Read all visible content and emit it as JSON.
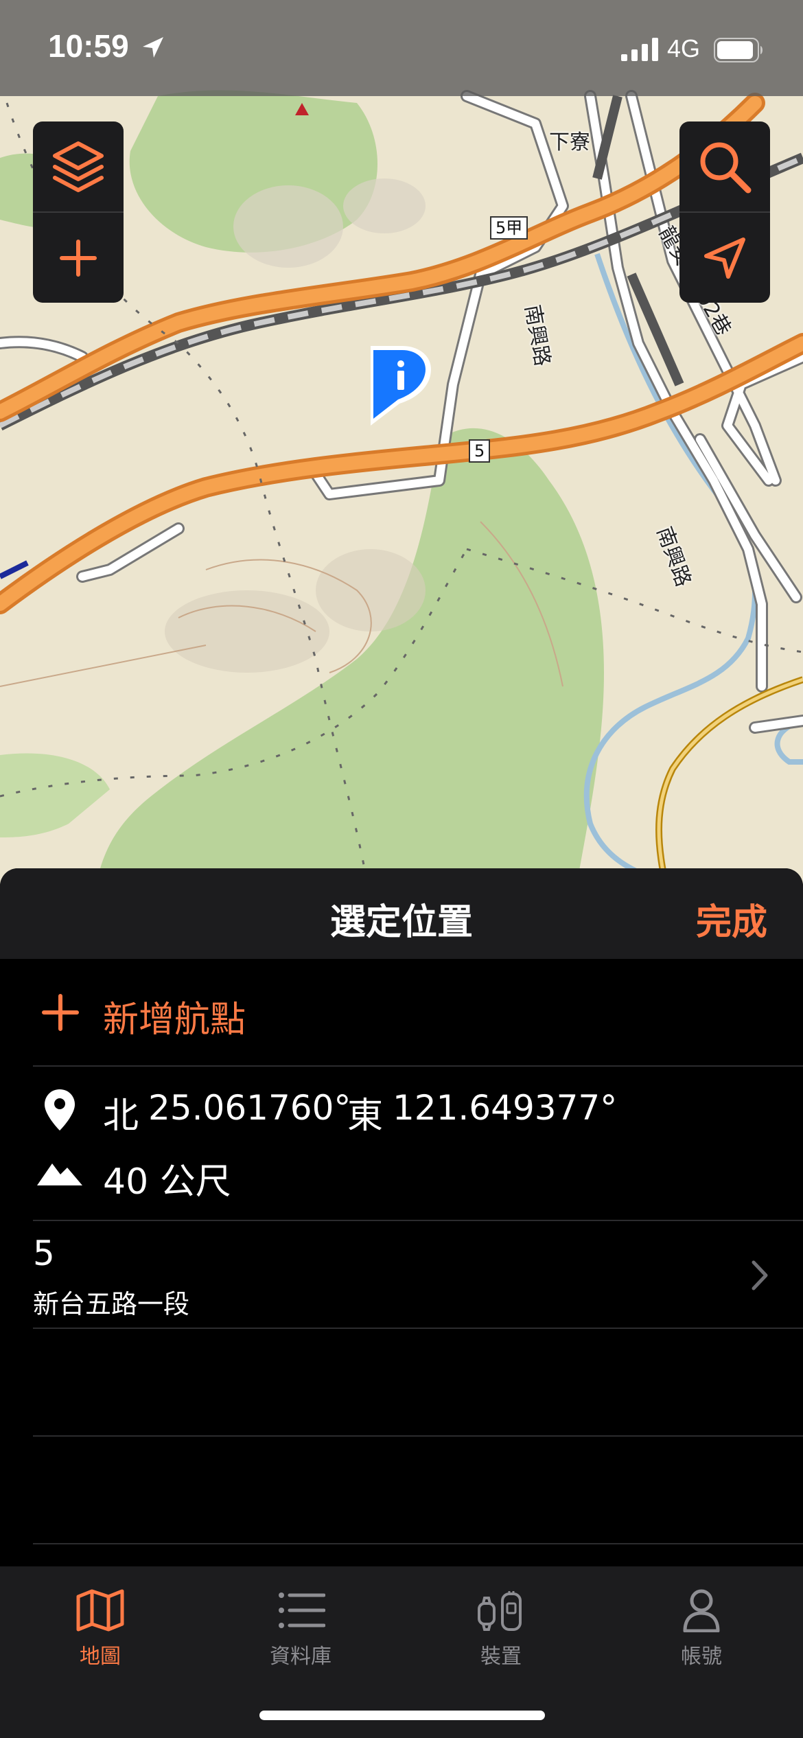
{
  "status_bar": {
    "time": "10:59",
    "network": "4G"
  },
  "map": {
    "labels": {
      "xialiao": "下寮",
      "route_5jia": "5甲",
      "route_5": "5",
      "nanxing_road_1": "南興路",
      "nanxing_road_2": "南興路",
      "longan_road": "龍安路102巷"
    },
    "buttons": [
      "layers",
      "zoom-in",
      "search",
      "locate"
    ]
  },
  "sheet": {
    "title": "選定位置",
    "done_label": "完成",
    "add_waypoint_label": "新增航點",
    "coordinates": {
      "lat_prefix": "北",
      "lat": "25.061760°",
      "lon_prefix": "東",
      "lon": "121.649377°"
    },
    "elevation": "40 公尺",
    "road": {
      "number": "5",
      "name": "新台五路一段"
    }
  },
  "tab_bar": {
    "tabs": [
      {
        "label": "地圖",
        "icon": "map-icon",
        "active": true
      },
      {
        "label": "資料庫",
        "icon": "list-icon",
        "active": false
      },
      {
        "label": "裝置",
        "icon": "device-icon",
        "active": false
      },
      {
        "label": "帳號",
        "icon": "person-icon",
        "active": false
      }
    ]
  },
  "colors": {
    "accent": "#ff7a45",
    "sheet_bg": "#000000",
    "header_bg": "#1c1c1e",
    "highway": "#f39a3c",
    "forest": "#b9d39a",
    "land": "#ece5cf",
    "marker": "#1677ff"
  }
}
